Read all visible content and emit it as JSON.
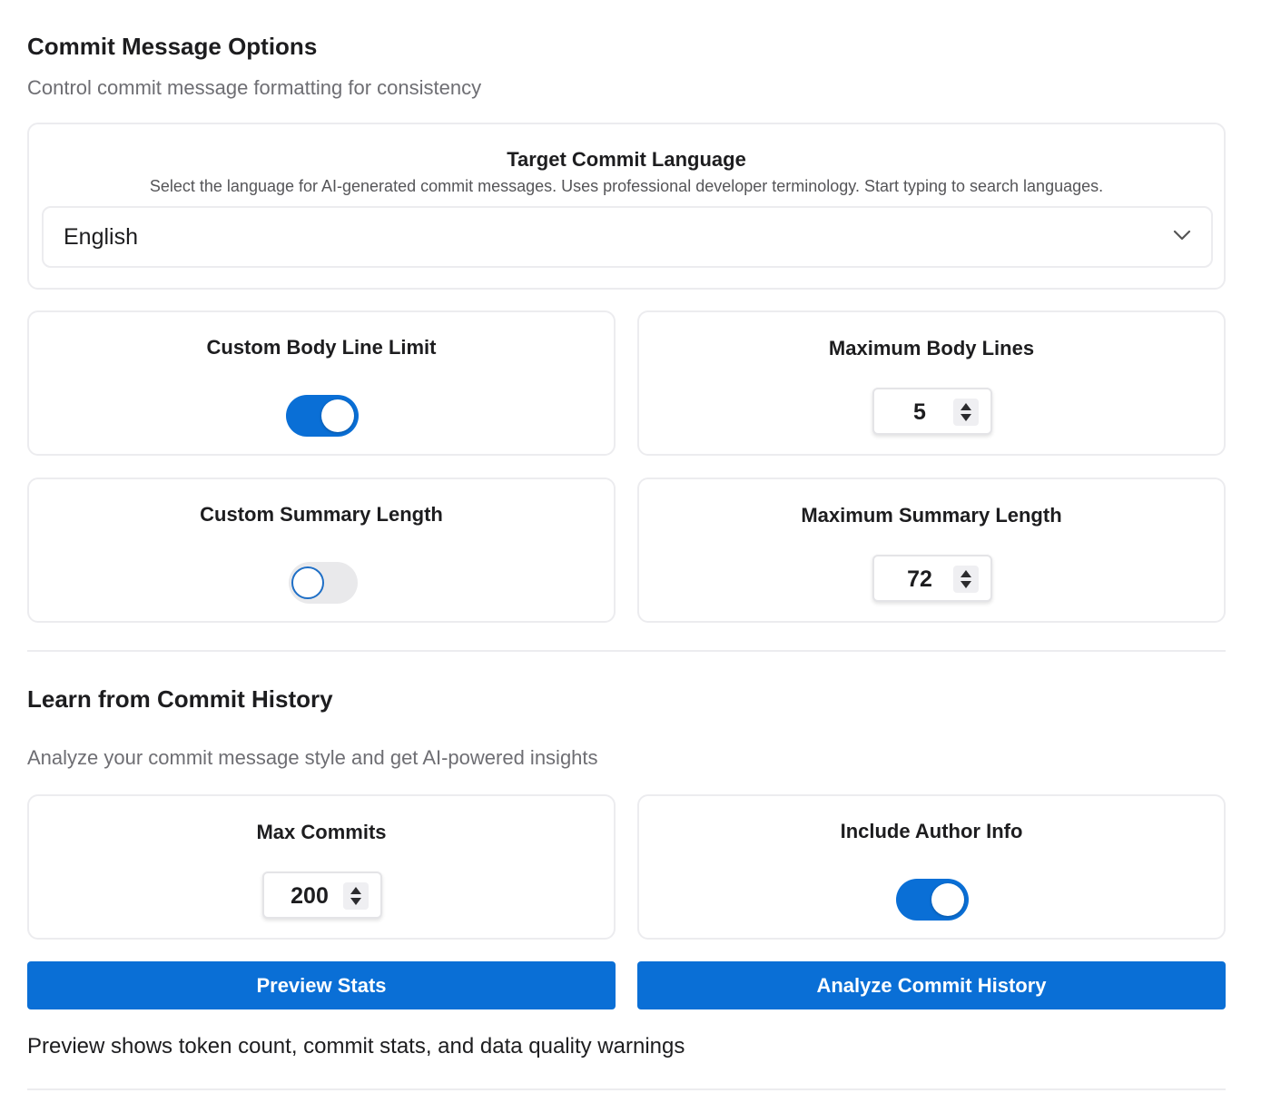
{
  "commit_options": {
    "title": "Commit Message Options",
    "subtitle": "Control commit message formatting for consistency",
    "language": {
      "title": "Target Commit Language",
      "description": "Select the language for AI-generated commit messages. Uses professional developer terminology. Start typing to search languages.",
      "selected": "English",
      "icon": "chevron-down-icon"
    },
    "body_line_limit": {
      "title": "Custom Body Line Limit",
      "enabled": true
    },
    "max_body_lines": {
      "title": "Maximum Body Lines",
      "value": "5"
    },
    "summary_length": {
      "title": "Custom Summary Length",
      "enabled": false
    },
    "max_summary_length": {
      "title": "Maximum Summary Length",
      "value": "72"
    }
  },
  "history": {
    "title": "Learn from Commit History",
    "subtitle": "Analyze your commit message style and get AI-powered insights",
    "max_commits": {
      "title": "Max Commits",
      "value": "200"
    },
    "include_author": {
      "title": "Include Author Info",
      "enabled": true
    },
    "preview_button": "Preview Stats",
    "analyze_button": "Analyze Commit History",
    "footnote": "Preview shows token count, commit stats, and data quality warnings"
  },
  "colors": {
    "accent": "#0a6fd6",
    "border": "#ececef",
    "muted_text": "#6e6e73"
  }
}
